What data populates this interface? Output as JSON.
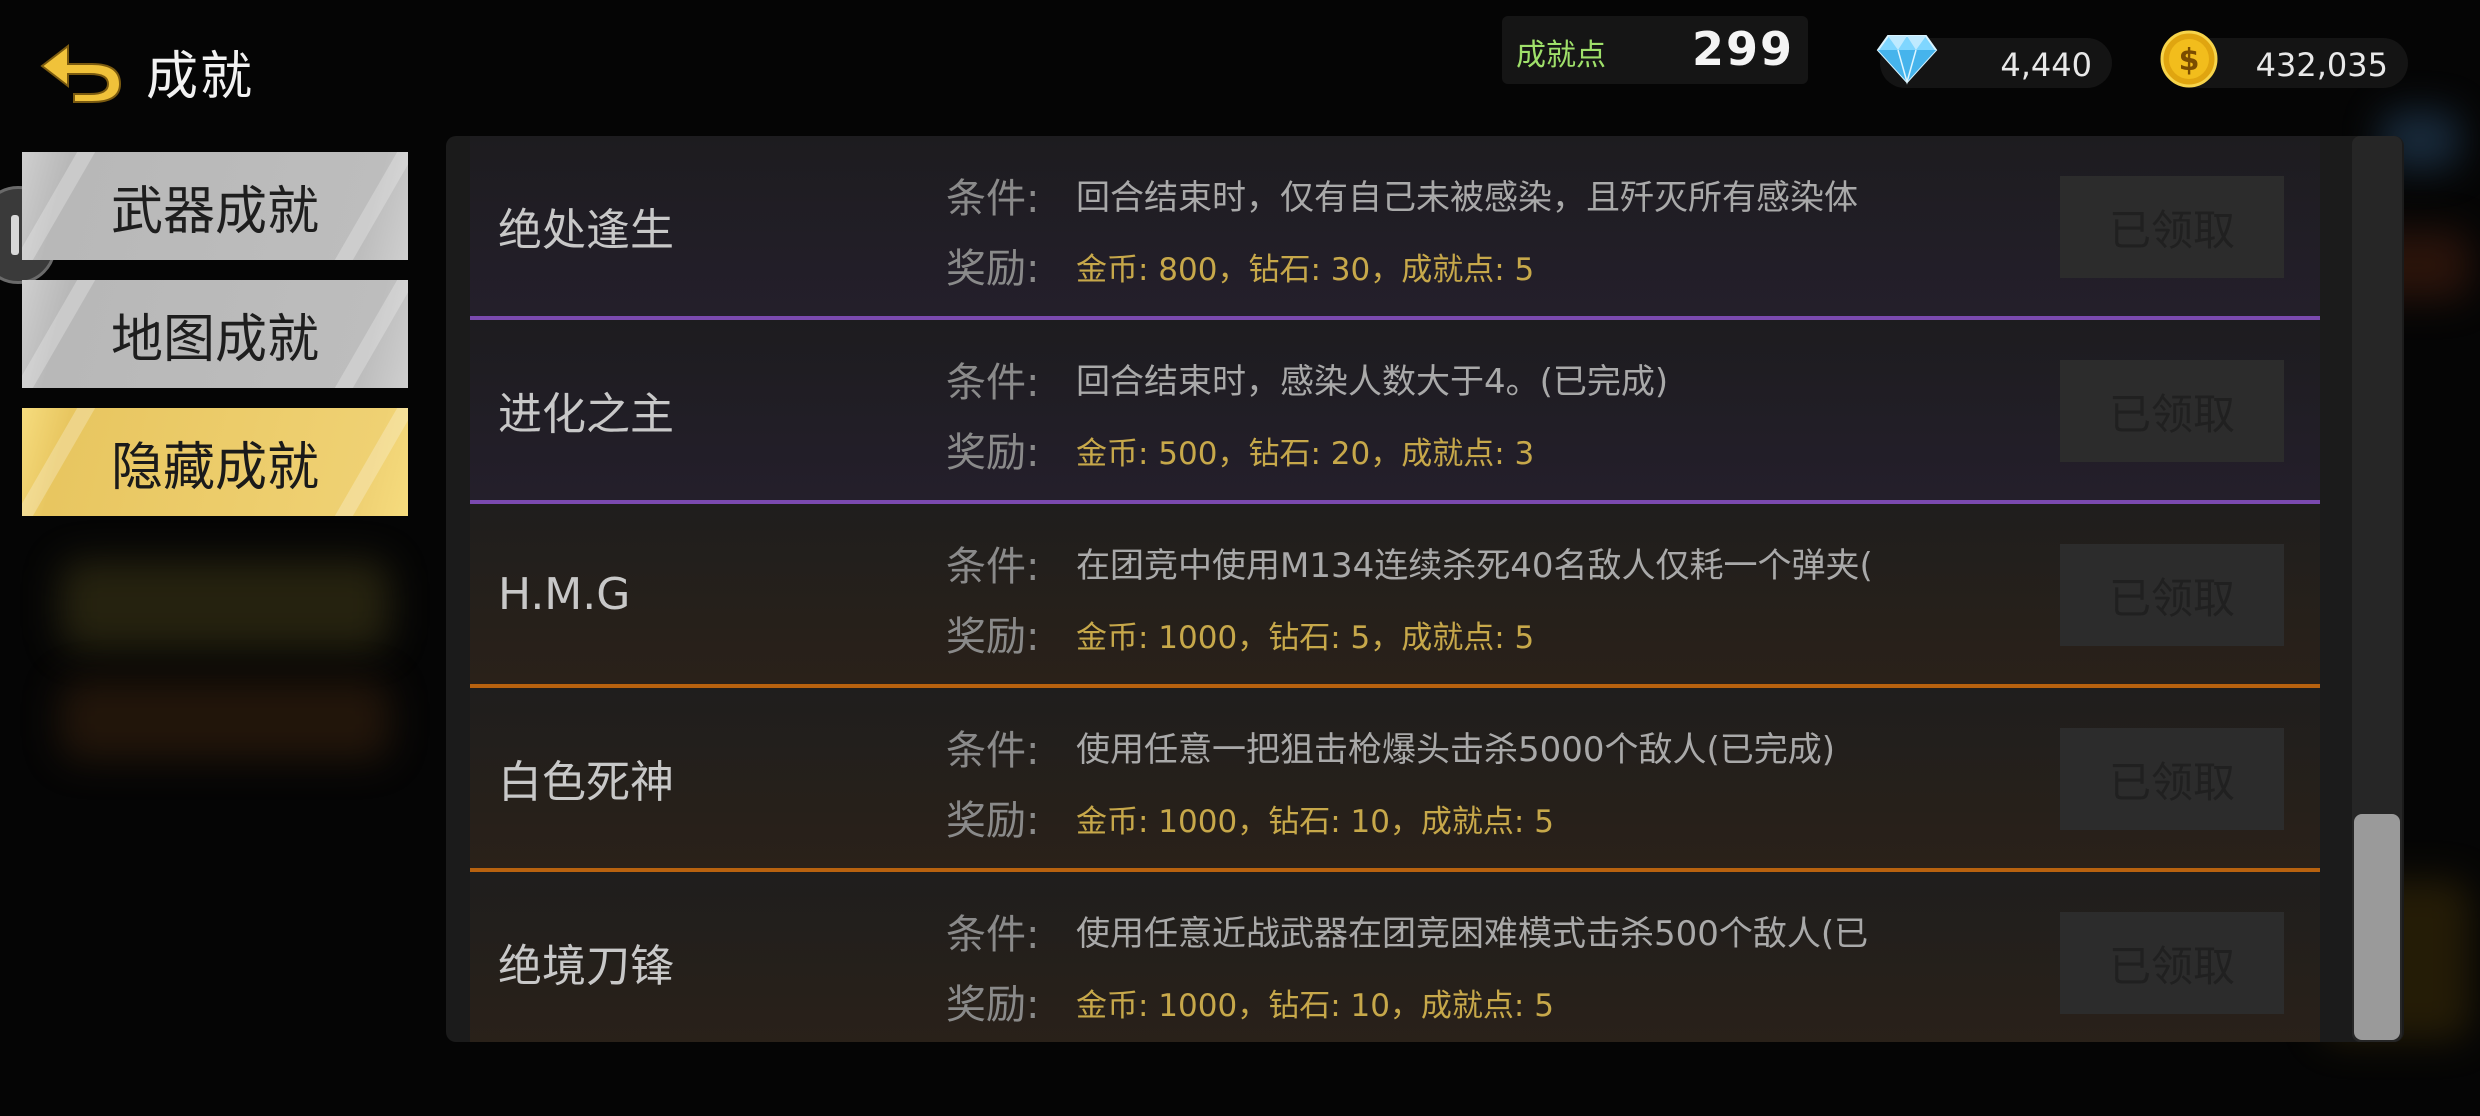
{
  "header": {
    "title": "成就",
    "achievement_points_label": "成就点",
    "achievement_points": "299",
    "diamonds": "4,440",
    "gold": "432,035"
  },
  "tabs": [
    {
      "label": "武器成就",
      "active": false
    },
    {
      "label": "地图成就",
      "active": false
    },
    {
      "label": "隐藏成就",
      "active": true
    }
  ],
  "list": {
    "condition_label": "条件:",
    "reward_label": "奖励:",
    "items": [
      {
        "name": "绝处逢生",
        "condition": "回合结束时，仅有自己未被感染，且歼灭所有感染体",
        "reward": "金币: 800，钻石: 30，成就点: 5",
        "button": "已领取",
        "tier": "purple"
      },
      {
        "name": "进化之主",
        "condition": "回合结束时，感染人数大于4。(已完成)",
        "reward": "金币: 500，钻石: 20，成就点: 3",
        "button": "已领取",
        "tier": "purple"
      },
      {
        "name": "H.M.G",
        "condition": "在团竞中使用M134连续杀死40名敌人仅耗一个弹夹(",
        "reward": "金币: 1000，钻石: 5，成就点: 5",
        "button": "已领取",
        "tier": "orange"
      },
      {
        "name": "白色死神",
        "condition": "使用任意一把狙击枪爆头击杀5000个敌人(已完成)",
        "reward": "金币: 1000，钻石: 10，成就点: 5",
        "button": "已领取",
        "tier": "orange"
      },
      {
        "name": "绝境刀锋",
        "condition": "使用任意近战武器在团竞困难模式击杀500个敌人(已",
        "reward": "金币: 1000，钻石: 10，成就点: 5",
        "button": "已领取",
        "tier": "orange"
      }
    ]
  },
  "icons": {
    "back": "back-arrow-icon",
    "diamond": "diamond-icon",
    "gold": "gold-coin-icon"
  },
  "colors": {
    "active_tab": "#ecd06e",
    "purple_divider": "#7b4ab0",
    "orange_divider": "#b8620f",
    "reward_text": "#c7a84a",
    "points_label": "#9fe06a"
  }
}
